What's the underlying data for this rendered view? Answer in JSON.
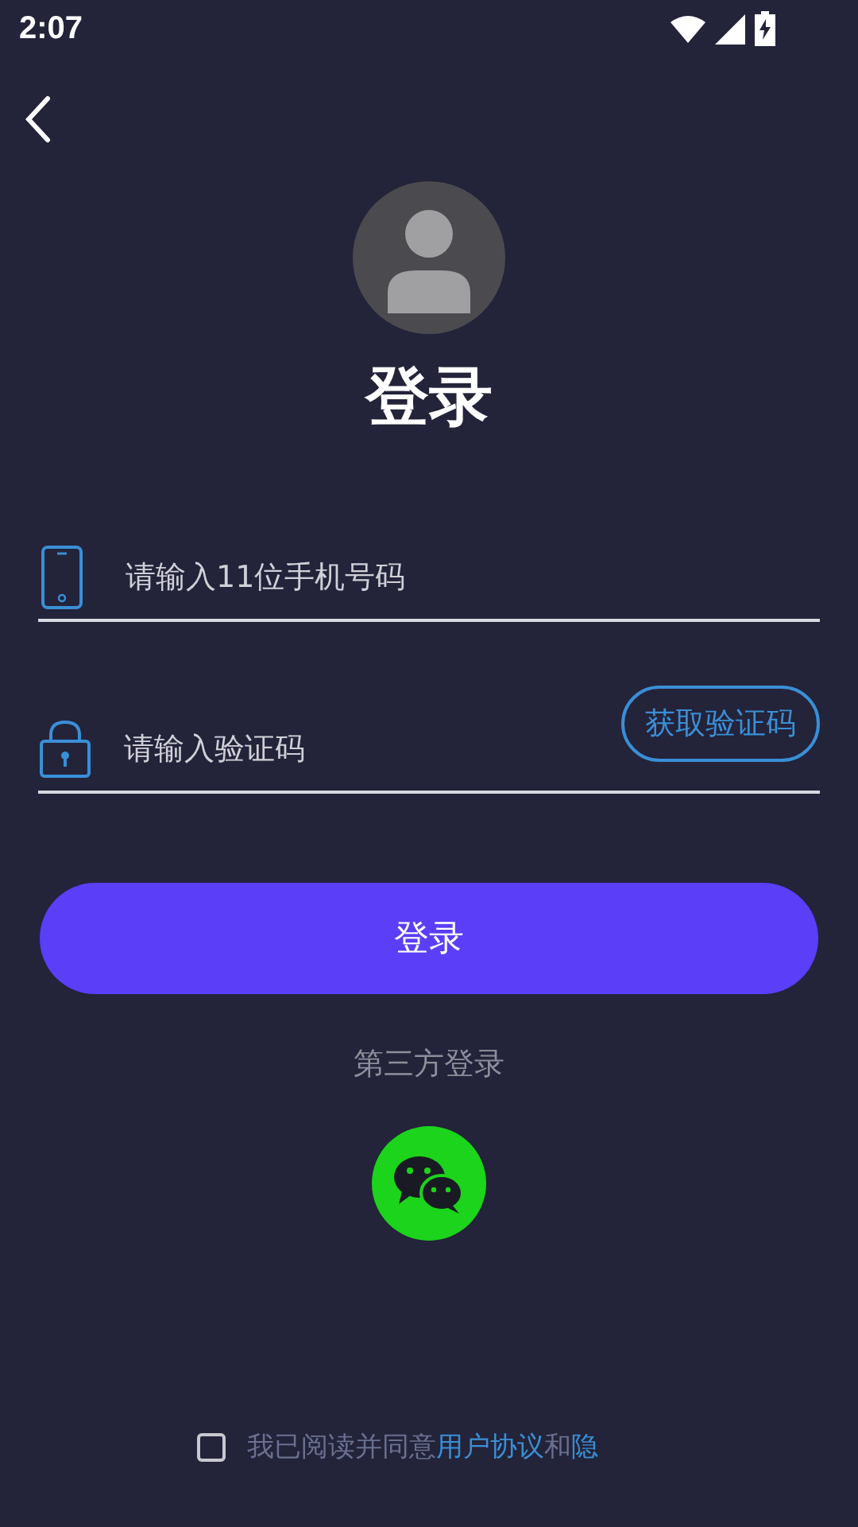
{
  "status_bar": {
    "time": "2:07"
  },
  "title": "登录",
  "phone_field": {
    "placeholder": "请输入11位手机号码"
  },
  "code_field": {
    "placeholder": "请输入验证码"
  },
  "get_code_button": "获取验证码",
  "login_button": "登录",
  "third_party": {
    "label": "第三方登录"
  },
  "agreement": {
    "checked": false,
    "parts": [
      {
        "kind": "text",
        "text": "我已阅读并同意"
      },
      {
        "kind": "link",
        "text": "用户协议"
      },
      {
        "kind": "text",
        "text": "和"
      },
      {
        "kind": "link",
        "text": "隐"
      }
    ]
  }
}
